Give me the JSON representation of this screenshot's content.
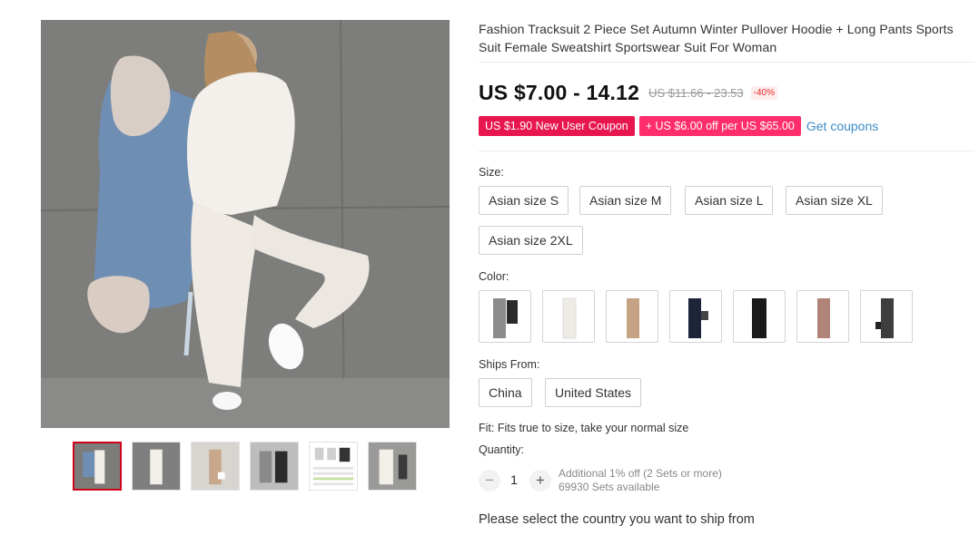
{
  "product": {
    "title": "Fashion Tracksuit 2 Piece Set Autumn Winter Pullover Hoodie + Long Pants Sports Suit Female Sweatshirt Sportswear Suit For Woman",
    "price": "US $7.00 - 14.12",
    "original_price": "US $11.66 - 23.53",
    "discount": "-40%"
  },
  "coupons": {
    "new_user": "US $1.90 New User Coupon",
    "store": "+ US $6.00 off per US $65.00",
    "get_link": "Get coupons"
  },
  "size": {
    "label": "Size:",
    "options": [
      "Asian size S",
      "Asian size M",
      "Asian size L",
      "Asian size XL",
      "Asian size 2XL"
    ]
  },
  "color": {
    "label": "Color:",
    "swatches": [
      "grey",
      "white",
      "khaki",
      "navy",
      "black",
      "pink",
      "dark-grey"
    ]
  },
  "ships_from": {
    "label": "Ships From:",
    "options": [
      "China",
      "United States"
    ]
  },
  "fit": "Fit: Fits true to size, take your normal size",
  "quantity": {
    "label": "Quantity:",
    "value": "1",
    "minus": "−",
    "plus": "+",
    "promo": "Additional 1% off (2 Sets or more)",
    "available": "69930 Sets available"
  },
  "ship_note": "Please select the country you want to ship from",
  "colors": {
    "accent_red": "#d0021b",
    "coupon_pink": "#e8164f",
    "link_blue": "#3d8cc6"
  }
}
